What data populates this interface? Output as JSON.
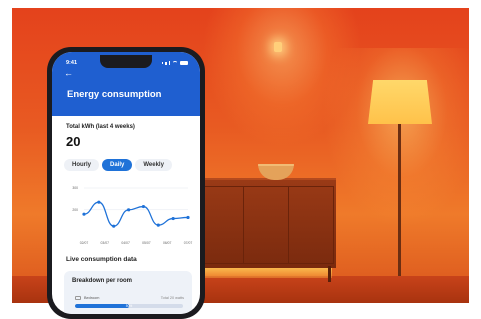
{
  "status_bar": {
    "time": "9:41"
  },
  "header": {
    "back_icon": "arrow-left-icon",
    "title": "Energy consumption"
  },
  "summary": {
    "label": "Total kWh (last 4 weeks)",
    "value": "20"
  },
  "tabs": [
    {
      "label": "Hourly",
      "active": false
    },
    {
      "label": "Daily",
      "active": true
    },
    {
      "label": "Weekly",
      "active": false
    }
  ],
  "chart_data": {
    "type": "line",
    "x": [
      "02/07",
      "03/07",
      "04/07",
      "05/07",
      "06/07",
      "07/07"
    ],
    "y_ticks": [
      "300",
      "200"
    ],
    "series": [
      {
        "values": [
          180,
          235,
          125,
          200,
          215,
          130,
          160,
          165
        ]
      }
    ],
    "point_x": [
      0,
      1,
      2,
      3,
      4,
      5,
      6,
      7
    ],
    "line_color": "#1f72d8",
    "ylim": [
      80,
      300
    ],
    "grid": true
  },
  "live": {
    "label": "Live consumption data"
  },
  "room_card": {
    "title": "Breakdown per room",
    "room_icon": "bed-icon",
    "room": "Bedroom",
    "total": "Total 20 watts",
    "percent_label": "50%",
    "percent": 50
  },
  "colors": {
    "accent": "#1f5fd0",
    "active_tab": "#1f72d8"
  }
}
